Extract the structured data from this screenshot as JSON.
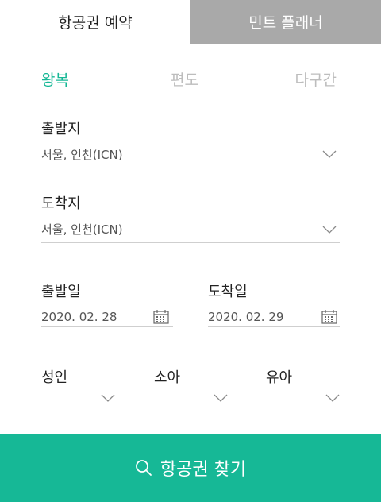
{
  "tabs": [
    {
      "label": "항공권 예약"
    },
    {
      "label": "민트 플래너"
    }
  ],
  "trip_types": [
    {
      "label": "왕복"
    },
    {
      "label": "편도"
    },
    {
      "label": "다구간"
    }
  ],
  "departure": {
    "label": "출발지",
    "value": "서울, 인천(ICN)"
  },
  "arrival": {
    "label": "도착지",
    "value": "서울, 인천(ICN)"
  },
  "depart_date": {
    "label": "출발일",
    "value": "2020. 02. 28"
  },
  "arrive_date": {
    "label": "도착일",
    "value": "2020. 02. 29"
  },
  "passengers": [
    {
      "label": "성인"
    },
    {
      "label": "소아"
    },
    {
      "label": "유아"
    }
  ],
  "search": {
    "label": "항공권 찾기"
  },
  "colors": {
    "accent": "#16b896",
    "inactive_tab": "#a9a9a9"
  }
}
